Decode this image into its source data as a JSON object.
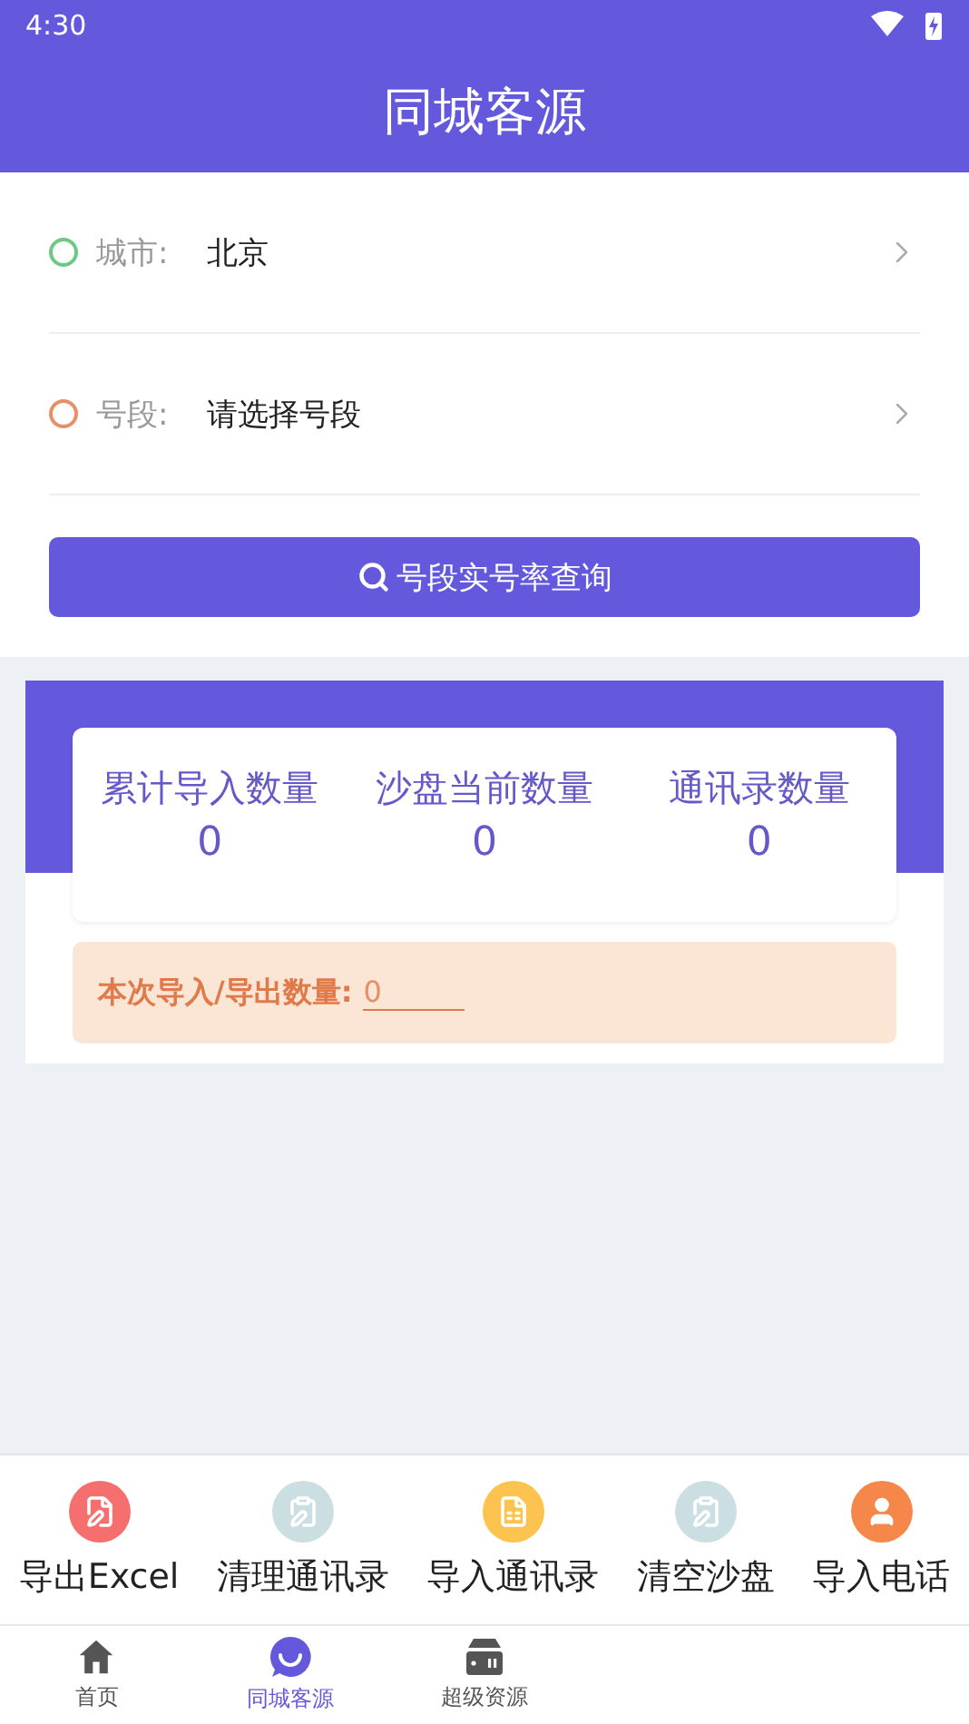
{
  "status_bar": {
    "time": "4:30"
  },
  "header": {
    "title": "同城客源"
  },
  "form": {
    "rows": [
      {
        "label": "城市:",
        "value": "北京",
        "color": "#6cc983"
      },
      {
        "label": "号段:",
        "value": "请选择号段",
        "color": "#e98f67"
      }
    ],
    "button": "号段实号率查询"
  },
  "stats": [
    {
      "label": "累计导入数量",
      "value": "0"
    },
    {
      "label": "沙盘当前数量",
      "value": "0"
    },
    {
      "label": "通讯录数量",
      "value": "0"
    }
  ],
  "batch": {
    "label": "本次导入/导出数量:",
    "value": "0"
  },
  "actions": [
    {
      "label": "导出Excel",
      "color": "#f56f6f",
      "kind": "export"
    },
    {
      "label": "清理通讯录",
      "color": "#cbdfe2",
      "kind": "clipboard"
    },
    {
      "label": "导入通讯录",
      "color": "#fcc44f",
      "kind": "import"
    },
    {
      "label": "清空沙盘",
      "color": "#cbdfe2",
      "kind": "clipboard"
    },
    {
      "label": "导入电话",
      "color": "#f5874b",
      "kind": "person"
    }
  ],
  "tabs": [
    {
      "label": "首页",
      "kind": "home",
      "selected": false
    },
    {
      "label": "同城客源",
      "kind": "chat",
      "selected": true
    },
    {
      "label": "超级资源",
      "kind": "server",
      "selected": false
    }
  ]
}
